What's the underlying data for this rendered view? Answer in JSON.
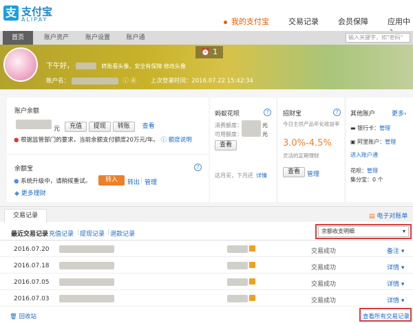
{
  "brand": {
    "name": "支付宝",
    "sub": "ALIPAY"
  },
  "nav": {
    "items": [
      {
        "label": "我的支付宝",
        "active": true
      },
      {
        "label": "交易记录",
        "active": false
      },
      {
        "label": "会员保障",
        "active": false
      },
      {
        "label": "应用中心",
        "active": false
      }
    ]
  },
  "subnav": {
    "tabs": [
      {
        "label": "首页",
        "active": true
      },
      {
        "label": "账户资产",
        "active": false
      },
      {
        "label": "账户设置",
        "active": false
      },
      {
        "label": "账户通",
        "active": false
      }
    ],
    "search_placeholder": "输入关键字，如\"密码\""
  },
  "banner": {
    "greeting": "下午好，",
    "avatar_hint": "转账看头像，安全有保障 修改头像",
    "account_label": "账户名：",
    "last_login": "上次登录时间：2016.07.22 15:42:34",
    "message_count": "1"
  },
  "balance": {
    "title": "账户余额",
    "unit": "元",
    "buttons": [
      "充值",
      "提现",
      "转账"
    ],
    "view": "查看",
    "notice": "根据监管部门的要求，当前余额支付额度20万元/年。",
    "notice_link": "额度说明"
  },
  "yuebao": {
    "title": "余额宝",
    "upgrade": "系统升级中，请稍候重试。",
    "transfer_in": "转入",
    "transfer_out": "转出",
    "manage": "管理",
    "more": "更多理财"
  },
  "huabei": {
    "title": "蚂蚁花呗",
    "consume_label": "消费额度：",
    "available_label": "可用额度：",
    "unit": "元",
    "view": "查看",
    "footer": "这月买，下月还",
    "detail": "详情"
  },
  "zhaocai": {
    "title": "招财宝",
    "desc": "今日主供产品年化收益率",
    "rate": "3.0%-4.5%",
    "note": "灵活的定期理财",
    "view": "查看",
    "manage": "管理"
  },
  "other": {
    "title": "其他账户",
    "more": "更多",
    "bank_label": "银行卡：",
    "bank_manage": "管理",
    "ali_label": "阿里账户：",
    "ali_manage": "管理",
    "enter": "进入账户通",
    "huacheng_label": "花呗：",
    "huacheng_manage": "管理",
    "jifen": "集分宝：0 个"
  },
  "transactions": {
    "tab": "交易记录",
    "ebill": "电子对账单",
    "filters": [
      "最近交易记录",
      "充值记录",
      "提现记录",
      "退款记录"
    ],
    "select": "余额收支明细",
    "rows": [
      {
        "date": "2016.07.20",
        "status": "交易成功",
        "action": "备注"
      },
      {
        "date": "2016.07.18",
        "status": "交易成功",
        "action": "详情"
      },
      {
        "date": "2016.07.05",
        "status": "交易成功",
        "action": "详情"
      },
      {
        "date": "2016.07.03",
        "status": "交易成功",
        "action": "详情"
      }
    ],
    "recycle": "回收站",
    "view_all": "查看所有交易记录"
  },
  "colors": {
    "accent": "#e55a00",
    "link": "#1e6ac8",
    "brand": "#1c9fe0",
    "highlight": "#d63b3b"
  }
}
